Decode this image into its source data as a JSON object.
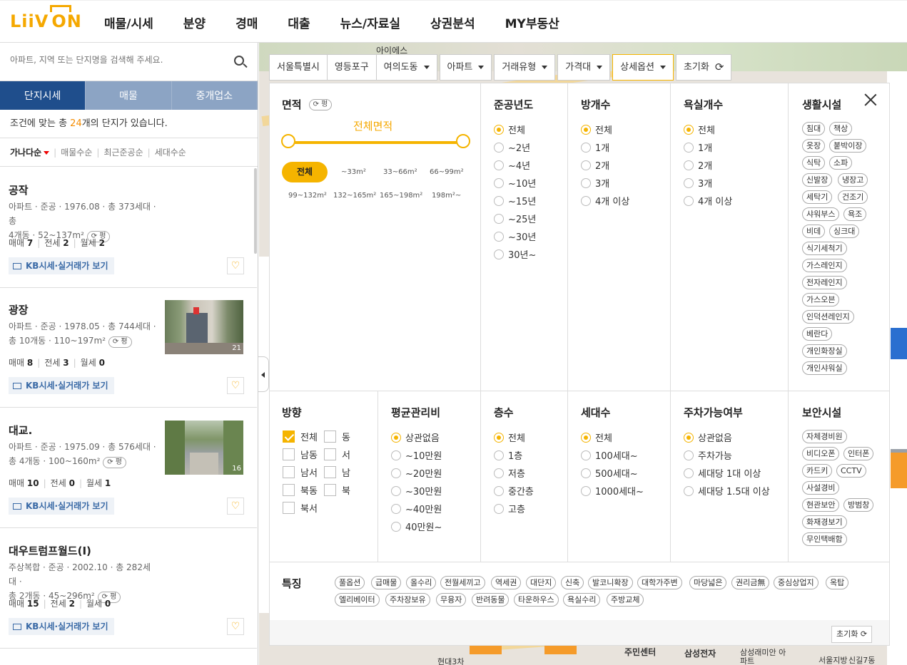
{
  "header": {
    "logo": "LIIV ON",
    "nav": [
      "매물/시세",
      "분양",
      "경매",
      "대출",
      "뉴스/자료실",
      "상권분석",
      "MY부동산"
    ]
  },
  "search": {
    "placeholder": "아파트, 지역 또는 단지명을 검색해 주세요."
  },
  "tabs": [
    "단지시세",
    "매물",
    "중개업소"
  ],
  "count": {
    "prefix": "조건에 맞는 총 ",
    "num": "24",
    "suffix": "개의 단지가 있습니다."
  },
  "sort": [
    "가나다순",
    "매물수순",
    "최근준공순",
    "세대수순"
  ],
  "items": [
    {
      "name": "공작",
      "line1": "아파트 · 준공 · 1976.08 · 총 373세대 · 총",
      "line2": "4개동 · 52~137m²",
      "pyeong": "평",
      "trade": [
        "매매",
        "7",
        "전세",
        "2",
        "월세",
        "2"
      ],
      "kb": "KB시세·실거래가 보기",
      "photo_count": ""
    },
    {
      "name": "광장",
      "line1": "아파트 · 준공 · 1978.05 · 총 744세대 ·",
      "line2": "총 10개동 · 110~197m²",
      "pyeong": "평",
      "trade": [
        "매매",
        "8",
        "전세",
        "3",
        "월세",
        "0"
      ],
      "kb": "KB시세·실거래가 보기",
      "photo_count": "21"
    },
    {
      "name": "대교.",
      "line1": "아파트 · 준공 · 1975.09 · 총 576세대 ·",
      "line2": "총 4개동 · 100~160m²",
      "pyeong": "평",
      "trade": [
        "매매",
        "10",
        "전세",
        "0",
        "월세",
        "1"
      ],
      "kb": "KB시세·실거래가 보기",
      "photo_count": "16"
    },
    {
      "name": "대우트럼프월드(I)",
      "line1": "주상복합 · 준공 · 2002.10 · 총 282세대 ·",
      "line2": "총 2개동 · 45~296m²",
      "pyeong": "평",
      "trade": [
        "매매",
        "15",
        "전세",
        "2",
        "월세",
        "0"
      ],
      "kb": "KB시세·실거래가 보기",
      "photo_count": ""
    }
  ],
  "filterbar": {
    "crumbs": [
      "서울특별시",
      "영등포구",
      "여의도동"
    ],
    "dropdowns": [
      "아파트",
      "거래유형",
      "가격대"
    ],
    "detail": "상세옵션",
    "reset": "초기화"
  },
  "panel": {
    "area": {
      "title": "면적",
      "pyeong": "평",
      "range_label": "전체면적",
      "all": "전체",
      "options": [
        "~33m²",
        "33~66m²",
        "66~99m²",
        "99~132m²",
        "132~165m²",
        "165~198m²",
        "198m²~"
      ]
    },
    "year": {
      "title": "준공년도",
      "options": [
        "전체",
        "~2년",
        "~4년",
        "~10년",
        "~15년",
        "~25년",
        "~30년",
        "30년~"
      ]
    },
    "rooms": {
      "title": "방개수",
      "options": [
        "전체",
        "1개",
        "2개",
        "3개",
        "4개 이상"
      ]
    },
    "baths": {
      "title": "욕실개수",
      "options": [
        "전체",
        "1개",
        "2개",
        "3개",
        "4개 이상"
      ]
    },
    "living": {
      "title": "생활시설",
      "tags": [
        "침대",
        "책상",
        "옷장",
        "붙박이장",
        "식탁",
        "소파",
        "신발장",
        "냉장고",
        "세탁기",
        "건조기",
        "샤워부스",
        "욕조",
        "비데",
        "싱크대",
        "식기세척기",
        "가스레인지",
        "전자레인지",
        "가스오븐",
        "인덕션레인지",
        "베란다",
        "개인화장실",
        "개인샤워실"
      ]
    },
    "direction": {
      "title": "방향",
      "options": [
        "전체",
        "동",
        "남동",
        "서",
        "남서",
        "남",
        "북동",
        "북",
        "북서"
      ]
    },
    "fee": {
      "title": "평균관리비",
      "options": [
        "상관없음",
        "~10만원",
        "~20만원",
        "~30만원",
        "~40만원",
        "40만원~"
      ]
    },
    "floor": {
      "title": "층수",
      "options": [
        "전체",
        "1층",
        "저층",
        "중간층",
        "고층"
      ]
    },
    "households": {
      "title": "세대수",
      "options": [
        "전체",
        "100세대~",
        "500세대~",
        "1000세대~"
      ]
    },
    "parking": {
      "title": "주차가능여부",
      "options": [
        "상관없음",
        "주차가능",
        "세대당 1대 이상",
        "세대당 1.5대 이상"
      ]
    },
    "security": {
      "title": "보안시설",
      "tags": [
        "자체경비원",
        "비디오폰",
        "인터폰",
        "카드키",
        "CCTV",
        "사설경비",
        "현관보안",
        "방범창",
        "화재경보기",
        "무인택배함"
      ]
    },
    "features": {
      "title": "특징",
      "tags": [
        "풀옵션",
        "급매물",
        "올수리",
        "전월세끼고",
        "역세권",
        "대단지",
        "신축",
        "발코니확장",
        "대학가주변",
        "마당넓은",
        "권리금無",
        "중심상업지",
        "옥탑",
        "엘리베이터",
        "주차장보유",
        "무융자",
        "반려동물",
        "타운하우스",
        "욕실수리",
        "주방교체"
      ]
    },
    "reset": "초기화"
  },
  "map_labels": [
    "아이에스",
    "주민센터",
    "삼성전자",
    "삼성래미안 아파트",
    "서울지방",
    "신길7동",
    "현대3차"
  ],
  "colors": {
    "accent": "#f5b400",
    "nav_active": "#1f4e8c",
    "tab_inactive": "#8ca4c4",
    "count_num": "#f58c00"
  }
}
